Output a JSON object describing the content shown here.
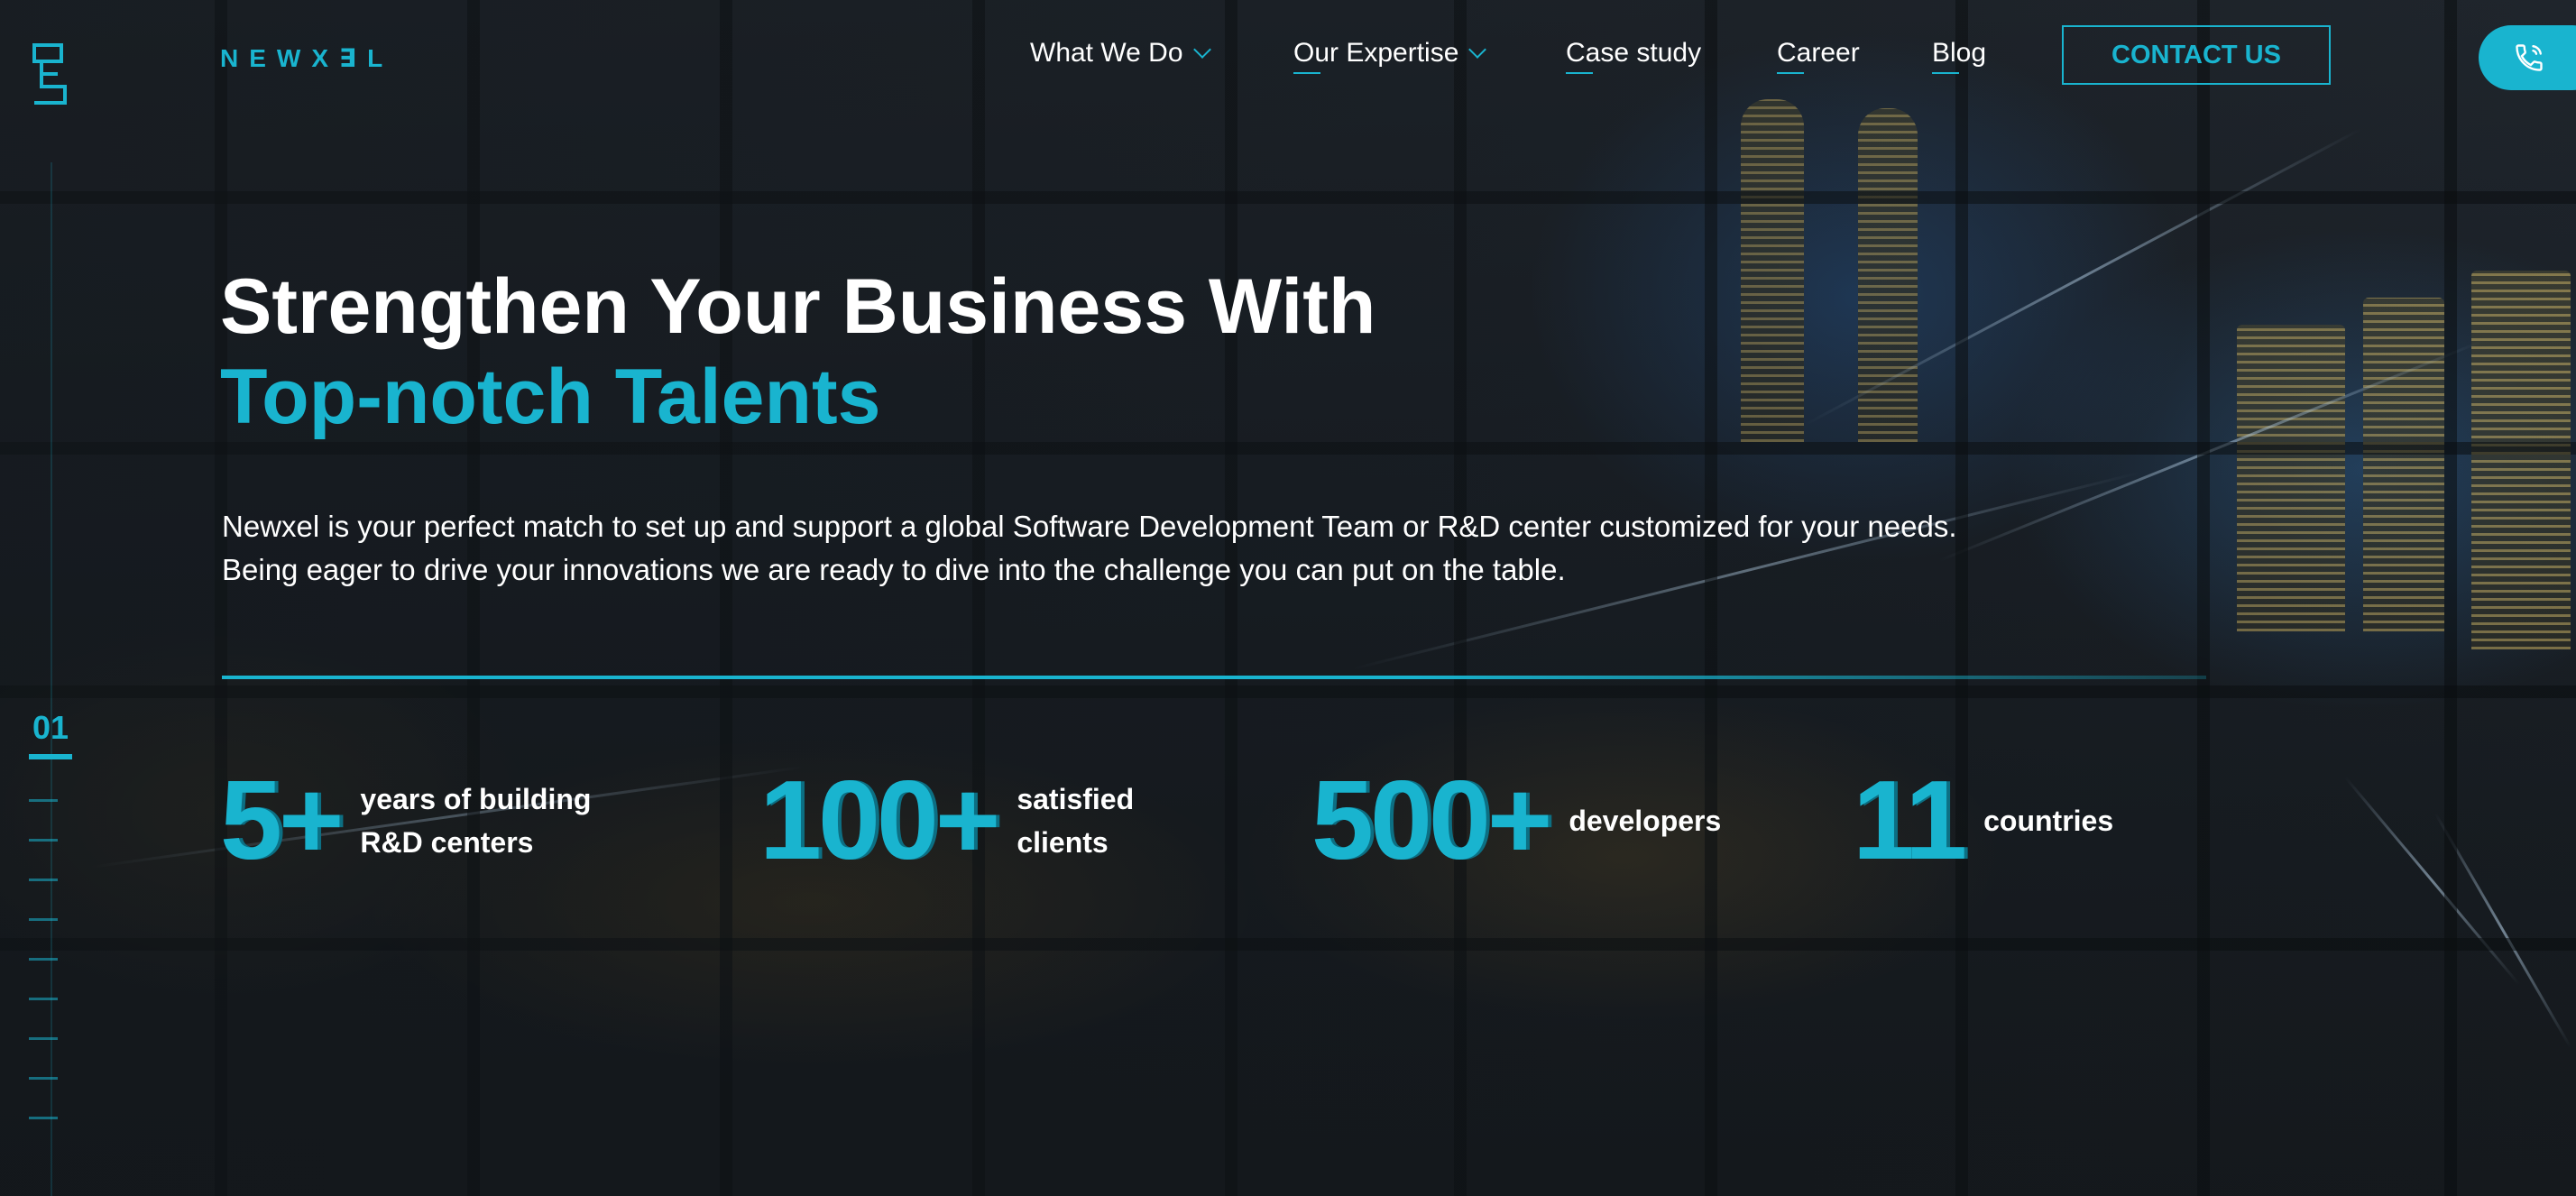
{
  "brand": {
    "wordmark": "NEWX∃L",
    "accent_color": "#19b4cf"
  },
  "nav": {
    "items": [
      {
        "label": "What We Do",
        "has_dropdown": true
      },
      {
        "label": "Our Expertise",
        "has_dropdown": true
      },
      {
        "label": "Case study",
        "has_dropdown": false
      },
      {
        "label": "Career",
        "has_dropdown": false
      },
      {
        "label": "Blog",
        "has_dropdown": false
      }
    ],
    "contact_label": "CONTACT US",
    "phone_icon": "phone-icon"
  },
  "hero": {
    "title_line1": "Strengthen Your Business With",
    "title_line2": "Top-notch Talents",
    "desc_line1": "Newxel is your perfect match to set up and support a global Software Development Team or R&D center customized for your needs.",
    "desc_line2": "Being eager to drive your innovations we are ready to dive into the challenge you can put on the table."
  },
  "slider": {
    "current": "01"
  },
  "stats": [
    {
      "value": "5+",
      "label_line1": "years of building",
      "label_line2": "R&D centers"
    },
    {
      "value": "100+",
      "label_line1": "satisfied",
      "label_line2": "clients"
    },
    {
      "value": "500+",
      "label_line1": "developers",
      "label_line2": ""
    },
    {
      "value": "11",
      "label_line1": "countries",
      "label_line2": ""
    }
  ]
}
